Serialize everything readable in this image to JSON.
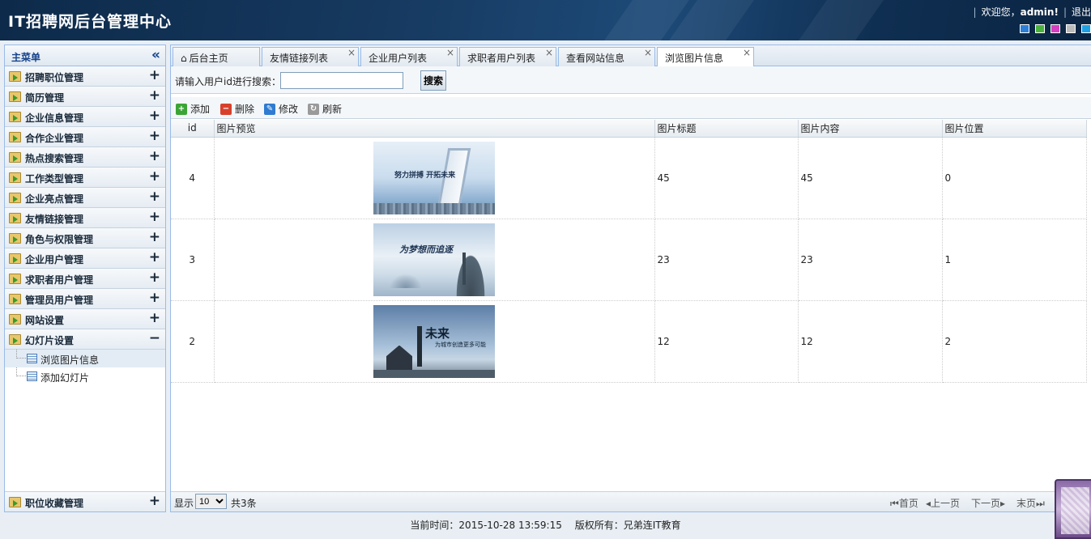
{
  "header": {
    "title": "IT招聘网后台管理中心",
    "welcome_prefix": "欢迎您，",
    "username": "admin!",
    "logout_label": "退出",
    "theme_colors": [
      "#2b7fd8",
      "#49b23c",
      "#d63fbf",
      "#bbbbbb",
      "#1fa0e3"
    ]
  },
  "menu": {
    "title": "主菜单",
    "groups": [
      {
        "label": "招聘职位管理",
        "toggle": "+"
      },
      {
        "label": "简历管理",
        "toggle": "+"
      },
      {
        "label": "企业信息管理",
        "toggle": "+"
      },
      {
        "label": "合作企业管理",
        "toggle": "+"
      },
      {
        "label": "热点搜索管理",
        "toggle": "+"
      },
      {
        "label": "工作类型管理",
        "toggle": "+"
      },
      {
        "label": "企业亮点管理",
        "toggle": "+"
      },
      {
        "label": "友情链接管理",
        "toggle": "+"
      },
      {
        "label": "角色与权限管理",
        "toggle": "+"
      },
      {
        "label": "企业用户管理",
        "toggle": "+"
      },
      {
        "label": "求职者用户管理",
        "toggle": "+"
      },
      {
        "label": "管理员用户管理",
        "toggle": "+"
      },
      {
        "label": "网站设置",
        "toggle": "+"
      },
      {
        "label": "幻灯片设置",
        "toggle": "−"
      }
    ],
    "subitems": [
      {
        "label": "浏览图片信息",
        "active": true
      },
      {
        "label": "添加幻灯片",
        "active": false
      }
    ],
    "bottom_group": {
      "label": "职位收藏管理",
      "toggle": "+"
    }
  },
  "tabs": [
    {
      "label": "后台主页",
      "closable": false
    },
    {
      "label": "友情链接列表",
      "closable": true
    },
    {
      "label": "企业用户列表",
      "closable": true
    },
    {
      "label": "求职者用户列表",
      "closable": true
    },
    {
      "label": "查看网站信息",
      "closable": true
    },
    {
      "label": "浏览图片信息",
      "closable": true,
      "active": true
    }
  ],
  "search": {
    "label": "请输入用户id进行搜索：",
    "value": "",
    "button": "搜索"
  },
  "toolbar": {
    "add": "添加",
    "delete": "删除",
    "edit": "修改",
    "refresh": "刷新"
  },
  "table": {
    "columns": [
      "id",
      "图片预览",
      "图片标题",
      "图片内容",
      "图片位置"
    ],
    "rows": [
      {
        "id": "4",
        "title": "45",
        "content": "45",
        "position": "0",
        "pic_text": "努力拼搏 开拓未来"
      },
      {
        "id": "3",
        "title": "23",
        "content": "23",
        "position": "1",
        "pic_text": "为梦想而追逐"
      },
      {
        "id": "2",
        "title": "12",
        "content": "12",
        "position": "2",
        "pic_text": "未来",
        "pic_subtext": "为城市创造更多可能"
      }
    ]
  },
  "pager": {
    "show_label": "显示",
    "page_size": "10",
    "total": "共3条",
    "first": "首页",
    "prev": "上一页",
    "next": "下一页",
    "last": "末页"
  },
  "footer": {
    "time_label": "当前时间：2015-10-28 13:59:15",
    "copyright": "版权所有：兄弟连IT教育"
  }
}
